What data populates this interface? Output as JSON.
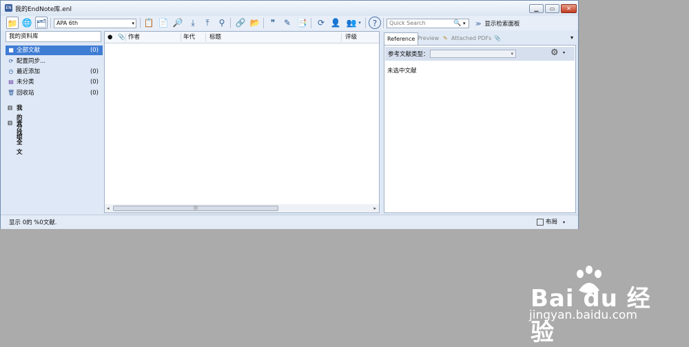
{
  "window": {
    "title": "我的EndNote库.enl",
    "app_icon_text": "EN",
    "min_symbol": "▁",
    "max_symbol": "▭",
    "close_symbol": "✕"
  },
  "toolbar": {
    "style_value": "APA 6th",
    "dropdown_arrow": "▾",
    "quick_search_placeholder": "Quick Search",
    "search_glyph": "🔍",
    "show_search_panel_label": "显示检索面板",
    "show_search_panel_chevron": "≫",
    "icons": {
      "local-library": "📁",
      "online-search": "🌐",
      "integrated-library": "🗂",
      "copy-library": "📋",
      "new-reference": "📄",
      "find-fulltext": "🔎",
      "import": "⤓",
      "export": "⤒",
      "find-by-author": "⚲",
      "open-link": "🔗",
      "open-file": "📂",
      "insert-citation": "❞",
      "edit-citation": "✎",
      "format-bibliography": "📑",
      "sync": "⟳",
      "share": "👤",
      "group": "👥",
      "help": "?"
    }
  },
  "left_panel": {
    "header": "我的资料库",
    "items": [
      {
        "label": "全部文献",
        "count": "(0)",
        "icon": "■"
      },
      {
        "label": "配置同步...",
        "count": "",
        "icon": "⟳"
      },
      {
        "label": "最近添加",
        "count": "(0)",
        "icon": "◷"
      },
      {
        "label": "未分类",
        "count": "(0)",
        "icon": "▤"
      },
      {
        "label": "回收站",
        "count": "(0)",
        "icon": "🗑"
      }
    ],
    "groups": [
      {
        "label": "我的分组",
        "toggle": "⊟"
      },
      {
        "label": "查找全文",
        "toggle": "⊟"
      }
    ]
  },
  "list": {
    "columns": {
      "read": "●",
      "attachment": "📎",
      "author": "作者",
      "year": "年代",
      "title": "标题",
      "rating": "评级"
    },
    "scroll_left": "◂",
    "scroll_right": "▸",
    "thumb_grip": "|||"
  },
  "right_panel": {
    "tabs": [
      "Reference",
      "Preview",
      "Attached PDFs"
    ],
    "attach_icon": "📎",
    "menu_glyph": "▾",
    "ref_type_label": "参考文献类型：",
    "ref_type_value": "",
    "gear_glyph": "⚙",
    "empty_text": "未选中文献"
  },
  "status": {
    "text": "显示 0的 %0文献.",
    "layout_label": "布局",
    "layout_arrow": "▾"
  },
  "watermark": {
    "brand": "Bai du 经验",
    "site": "jingyan.baidu.com"
  }
}
